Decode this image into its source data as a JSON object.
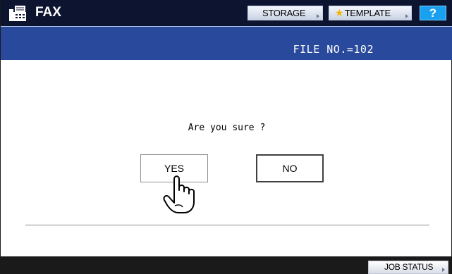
{
  "header": {
    "app_title": "FAX",
    "app_icon": "fax-machine-icon",
    "storage_label": "STORAGE",
    "template_label": "TEMPLATE",
    "template_icon": "star-icon",
    "help_label": "?"
  },
  "info": {
    "file_no": "FILE NO.=102"
  },
  "dialog": {
    "prompt": "Are you sure ?",
    "yes_label": "YES",
    "no_label": "NO",
    "pointer_icon": "hand-pointer-icon"
  },
  "footer": {
    "job_status_label": "JOB STATUS"
  },
  "colors": {
    "titlebar": "#0c1430",
    "infobar": "#294a9c",
    "help": "#1aa0f0",
    "star": "#f0b400"
  }
}
